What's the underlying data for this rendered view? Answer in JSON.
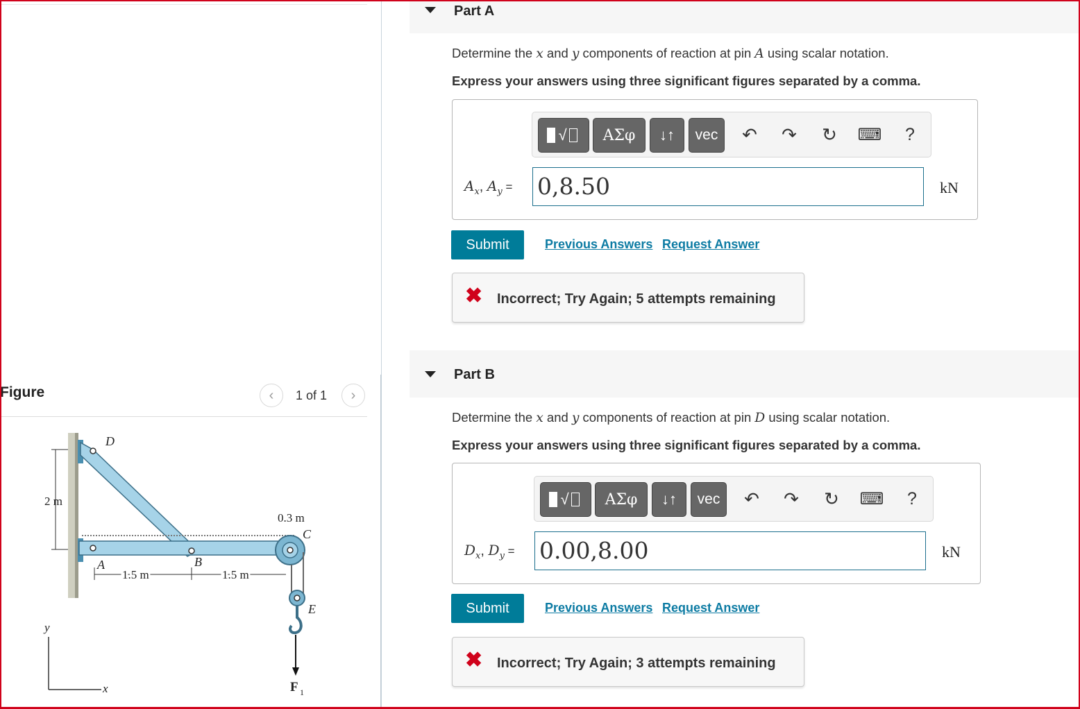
{
  "figure": {
    "title": "Figure",
    "counter": "1 of 1",
    "labels": {
      "D": "D",
      "A": "A",
      "B": "B",
      "C": "C",
      "E": "E",
      "dim_2m": "2 m",
      "dim_03m": "0.3 m",
      "dim_15m_a": "1.5 m",
      "dim_15m_b": "1.5 m",
      "axis_y": "y",
      "axis_x": "x",
      "force": "F",
      "force_sub": "1"
    }
  },
  "part_a": {
    "title": "Part A",
    "question_parts": [
      "Determine the ",
      "x",
      " and ",
      "y",
      " components of reaction at pin ",
      "A",
      " using scalar notation."
    ],
    "instruction": "Express your answers using three significant figures separated by a comma.",
    "toolbar": {
      "templates": "√",
      "greek": "ΑΣφ",
      "arrows": "↓↑",
      "vec": "vec",
      "help": "?"
    },
    "answer_label_parts": [
      "A",
      "x",
      ", ",
      "A",
      "y",
      " ="
    ],
    "answer_value": "0,8.50",
    "unit": "kN",
    "submit": "Submit",
    "previous_answers": "Previous Answers",
    "request_answer": "Request Answer",
    "feedback": "Incorrect; Try Again; 5 attempts remaining"
  },
  "part_b": {
    "title": "Part B",
    "question_parts": [
      "Determine the ",
      "x",
      " and ",
      "y",
      " components of reaction at pin ",
      "D",
      " using scalar notation."
    ],
    "instruction": "Express your answers using three significant figures separated by a comma.",
    "toolbar": {
      "templates": "√",
      "greek": "ΑΣφ",
      "arrows": "↓↑",
      "vec": "vec",
      "help": "?"
    },
    "answer_label_parts": [
      "D",
      "x",
      ", ",
      "D",
      "y",
      " ="
    ],
    "answer_value": "0.00,8.00",
    "unit": "kN",
    "submit": "Submit",
    "previous_answers": "Previous Answers",
    "request_answer": "Request Answer",
    "feedback": "Incorrect; Try Again; 3 attempts remaining"
  },
  "colors": {
    "accent": "#007c99",
    "link": "#0c7ba3",
    "error": "#d0021b",
    "frame": "#d0021b",
    "member": "#a6d3e8"
  },
  "icons": [
    "undo-icon",
    "redo-icon",
    "reset-icon",
    "keyboard-icon",
    "help-icon",
    "error-x-icon",
    "chevron-left-icon",
    "chevron-right-icon",
    "caret-down-icon"
  ]
}
